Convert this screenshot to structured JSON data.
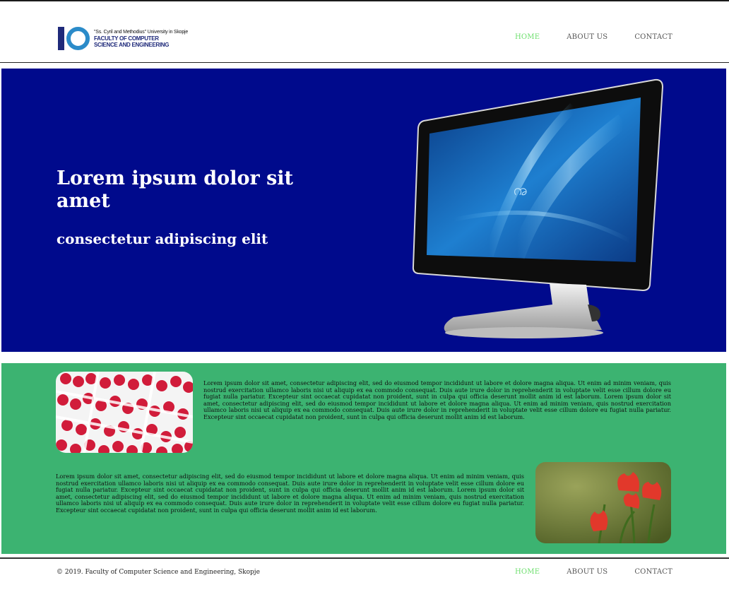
{
  "logo": {
    "university": "\"Ss. Cyril and Methodius\" University in Skopje",
    "faculty_line1": "FACULTY OF COMPUTER",
    "faculty_line2": "SCIENCE AND ENGINEERING",
    "icon": "finki-logo"
  },
  "nav": {
    "items": [
      {
        "label": "HOME",
        "active": true
      },
      {
        "label": "ABOUT US",
        "active": false
      },
      {
        "label": "CONTACT",
        "active": false
      }
    ]
  },
  "hero": {
    "title": "Lorem ipsum dolor sit amet",
    "subtitle": "consectetur adipiscing elit",
    "background": "#000a8c",
    "image": "monitor-image"
  },
  "content": {
    "background": "#3cb371",
    "paragraph1": "Lorem ipsum dolor sit amet, consectetur adipiscing elit, sed do eiusmod tempor incididunt ut labore et dolore magna aliqua. Ut enim ad minim veniam, quis nostrud exercitation ullamco laboris nisi ut aliquip ex ea commodo consequat. Duis aute irure dolor in reprehenderit in voluptate velit esse cillum dolore eu fugiat nulla pariatur. Excepteur sint occaecat cupidatat non proident, sunt in culpa qui officia deserunt mollit anim id est laborum. Lorem ipsum dolor sit amet, consectetur adipiscing elit, sed do eiusmod tempor incididunt ut labore et dolore magna aliqua. Ut enim ad minim veniam, quis nostrud exercitation ullamco laboris nisi ut aliquip ex ea commodo consequat. Duis aute irure dolor in reprehenderit in voluptate velit esse cillum dolore eu fugiat nulla pariatur. Excepteur sint occaecat cupidatat non proident, sunt in culpa qui officia deserunt mollit anim id est laborum.",
    "paragraph2": "Lorem ipsum dolor sit amet, consectetur adipiscing elit, sed do eiusmod tempor incididunt ut labore et dolore magna aliqua. Ut enim ad minim veniam, quis nostrud exercitation ullamco laboris nisi ut aliquip ex ea commodo consequat. Duis aute irure dolor in reprehenderit in voluptate velit esse cillum dolore eu fugiat nulla pariatur. Excepteur sint occaecat cupidatat non proident, sunt in culpa qui officia deserunt mollit anim id est laborum. Lorem ipsum dolor sit amet, consectetur adipiscing elit, sed do eiusmod tempor incididunt ut labore et dolore magna aliqua. Ut enim ad minim veniam, quis nostrud exercitation ullamco laboris nisi ut aliquip ex ea commodo consequat. Duis aute irure dolor in reprehenderit in voluptate velit esse cillum dolore eu fugiat nulla pariatur. Excepteur sint occaecat cupidatat non proident, sunt in culpa qui officia deserunt mollit anim id est laborum.",
    "image1": "raspberries-image",
    "image2": "tulips-image"
  },
  "footer": {
    "copyright": "© 2019. Faculty of Computer Science and Engineering, Skopje",
    "nav": [
      {
        "label": "HOME",
        "active": true
      },
      {
        "label": "ABOUT US",
        "active": false
      },
      {
        "label": "CONTACT",
        "active": false
      }
    ]
  },
  "colors": {
    "nav_active": "#6ddf6d",
    "nav_default": "#555555"
  }
}
